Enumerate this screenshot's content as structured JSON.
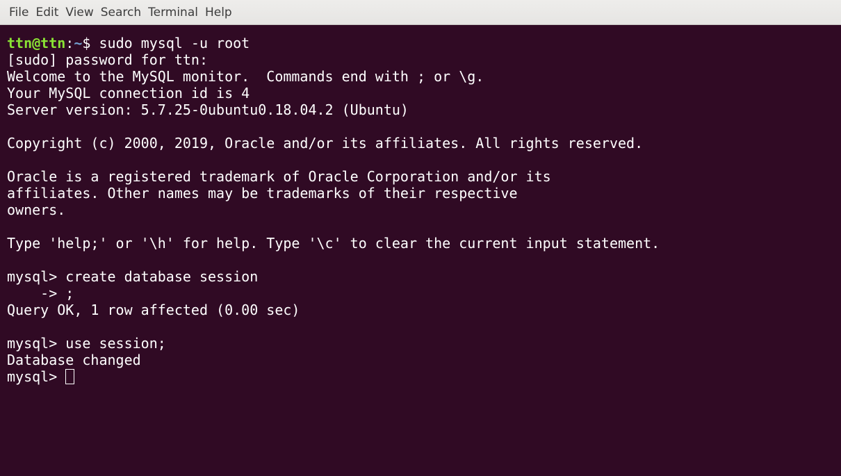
{
  "menubar": {
    "items": [
      "File",
      "Edit",
      "View",
      "Search",
      "Terminal",
      "Help"
    ]
  },
  "terminal": {
    "prompt": {
      "user_host": "ttn@ttn",
      "colon": ":",
      "path": "~",
      "symbol": "$ ",
      "command": "sudo mysql -u root"
    },
    "lines": [
      "[sudo] password for ttn:",
      "Welcome to the MySQL monitor.  Commands end with ; or \\g.",
      "Your MySQL connection id is 4",
      "Server version: 5.7.25-0ubuntu0.18.04.2 (Ubuntu)",
      "",
      "Copyright (c) 2000, 2019, Oracle and/or its affiliates. All rights reserved.",
      "",
      "Oracle is a registered trademark of Oracle Corporation and/or its",
      "affiliates. Other names may be trademarks of their respective",
      "owners.",
      "",
      "Type 'help;' or '\\h' for help. Type '\\c' to clear the current input statement.",
      "",
      "mysql> create database session",
      "    -> ;",
      "Query OK, 1 row affected (0.00 sec)",
      "",
      "mysql> use session;",
      "Database changed"
    ],
    "current_prompt": "mysql> "
  }
}
